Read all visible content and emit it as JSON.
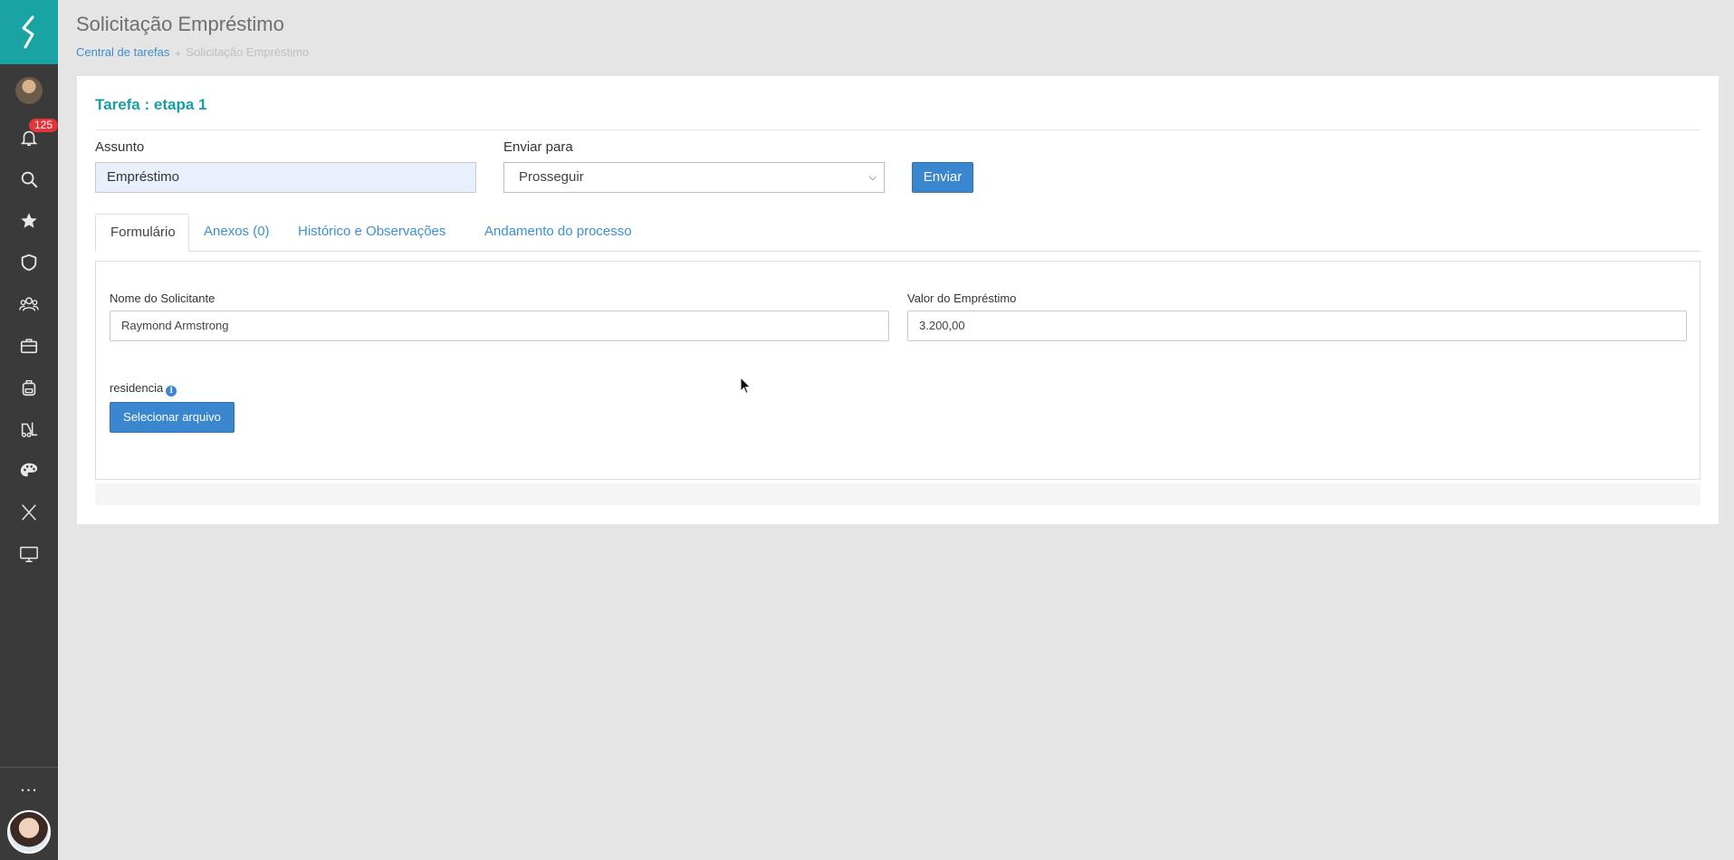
{
  "sidebar": {
    "notifications_count": "125",
    "icons": [
      "bell-icon",
      "search-icon",
      "star-icon",
      "shield-icon",
      "people-icon",
      "briefcase-icon",
      "backpack-icon",
      "forklift-icon",
      "palette-icon",
      "x-icon",
      "monitor-icon"
    ],
    "more_label": "..."
  },
  "header": {
    "title": "Solicitação Empréstimo",
    "breadcrumb": {
      "link": "Central de tarefas",
      "current": "Solicitação Empréstimo"
    }
  },
  "task": {
    "title": "Tarefa : etapa 1",
    "subject_label": "Assunto",
    "subject_value": "Empréstimo",
    "send_to_label": "Enviar para",
    "send_to_value": "Prosseguir",
    "send_button": "Enviar"
  },
  "tabs": [
    {
      "label": "Formulário",
      "active": true
    },
    {
      "label": "Anexos (0)",
      "active": false
    },
    {
      "label": "Histórico e Observações",
      "active": false
    },
    {
      "label": "Andamento do processo",
      "active": false
    }
  ],
  "form": {
    "requester_label": "Nome do Solicitante",
    "requester_value": "Raymond Armstrong",
    "amount_label": "Valor do Empréstimo",
    "amount_value": "3.200,00",
    "residence_label": "residencia",
    "select_file_button": "Selecionar arquivo"
  },
  "colors": {
    "brand": "#1aa3a3",
    "accent": "#3b87cf",
    "sidebar": "#3a3a3a",
    "badge": "#e5333a"
  }
}
